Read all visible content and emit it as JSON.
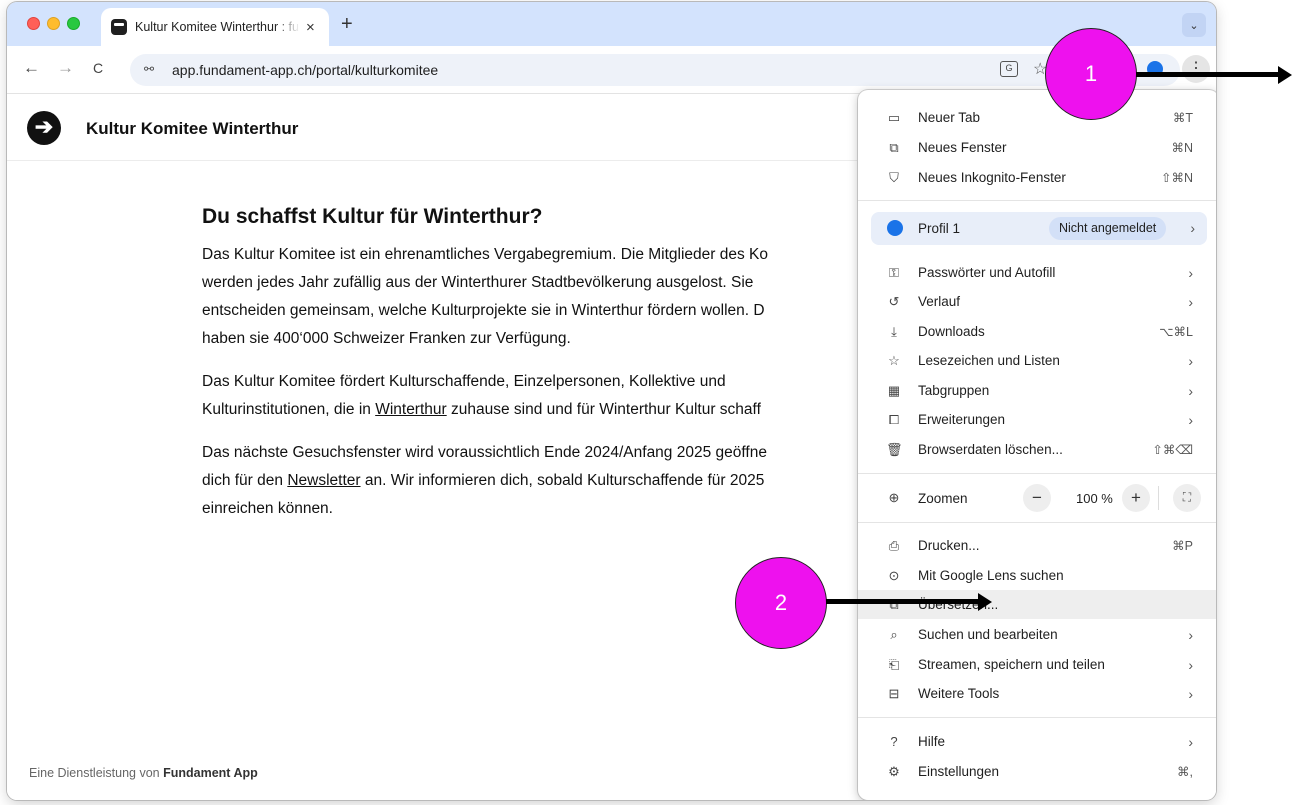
{
  "browser": {
    "tab_title": "Kultur Komitee Winterthur : fu",
    "tab_close": "×",
    "new_tab": "+",
    "tab_search": "⌄",
    "back": "←",
    "forward": "→",
    "reload": "C",
    "site_info": "⚯",
    "url": "app.fundament-app.ch/portal/kulturkomitee",
    "translate": "G",
    "bookmark": "☆",
    "menu": "⋮"
  },
  "site": {
    "logo_glyph": "➔",
    "name": "Kultur Komitee Winterthur",
    "headline": "Du schaffst Kultur für Winterthur?",
    "p1": [
      "Das Kultur Komitee ist ein ehrenamtliches Vergabegremium. Die Mitglieder des Ko",
      "werden jedes Jahr zufällig aus der Winterthurer Stadtbevölkerung ausgelost. Sie",
      "entscheiden gemeinsam, welche Kulturprojekte sie in Winterthur fördern wollen. D",
      "haben sie 400‘000 Schweizer Franken zur Verfügung."
    ],
    "p2_line1": "Das Kultur Komitee fördert Kulturschaffende, Einzelpersonen, Kollektive und",
    "p2_line2_before": "Kulturinstitutionen, die in ",
    "p2_link": "Winterthur",
    "p2_line2_after": " zuhause sind und für Winterthur Kultur schaff",
    "p3_line1": "Das nächste Gesuchsfenster wird voraussichtlich Ende 2024/Anfang 2025 geöffne",
    "p3_line2_before": "dich für den ",
    "p3_link": "Newsletter",
    "p3_line2_after": " an. Wir informieren dich, sobald Kulturschaffende für 2025",
    "p3_line3": "einreichen können.",
    "footer_prefix": "Eine Dienstleistung von ",
    "footer_brand": "Fundament App"
  },
  "menu": {
    "new_tab": {
      "icon": "▭",
      "label": "Neuer Tab",
      "shortcut": "⌘T"
    },
    "new_window": {
      "icon": "⧉",
      "label": "Neues Fenster",
      "shortcut": "⌘N"
    },
    "incognito": {
      "icon": "⛉",
      "label": "Neues Inkognito-Fenster",
      "shortcut": "⇧⌘N"
    },
    "profile": {
      "label": "Profil 1",
      "badge": "Nicht angemeldet",
      "arrow": "›"
    },
    "passwords": {
      "icon": "⚿",
      "label": "Passwörter und Autofill",
      "arrow": "›"
    },
    "history": {
      "icon": "↺",
      "label": "Verlauf",
      "arrow": "›"
    },
    "downloads": {
      "icon": "⤓",
      "label": "Downloads",
      "shortcut": "⌥⌘L"
    },
    "bookmarks": {
      "icon": "☆",
      "label": "Lesezeichen und Listen",
      "arrow": "›"
    },
    "tabgroups": {
      "icon": "▦",
      "label": "Tabgruppen",
      "arrow": "›"
    },
    "extensions": {
      "icon": "⧠",
      "label": "Erweiterungen",
      "arrow": "›"
    },
    "clear_data": {
      "icon": "🗑",
      "label": "Browserdaten löschen...",
      "shortcut": "⇧⌘⌫"
    },
    "zoom": {
      "icon": "⊕",
      "label": "Zoomen",
      "minus": "−",
      "value": "100 %",
      "plus": "+",
      "fullscreen": "⛶"
    },
    "print": {
      "icon": "⎙",
      "label": "Drucken...",
      "shortcut": "⌘P"
    },
    "lens": {
      "icon": "⊙",
      "label": "Mit Google Lens suchen"
    },
    "translate": {
      "icon": "⧉",
      "label": "Übersetzen..."
    },
    "find_edit": {
      "icon": "⌕",
      "label": "Suchen und bearbeiten",
      "arrow": "›"
    },
    "cast_save": {
      "icon": "⎗",
      "label": "Streamen, speichern und teilen",
      "arrow": "›"
    },
    "more_tools": {
      "icon": "⊟",
      "label": "Weitere Tools",
      "arrow": "›"
    },
    "help": {
      "icon": "?",
      "label": "Hilfe",
      "arrow": "›"
    },
    "settings": {
      "icon": "⚙",
      "label": "Einstellungen",
      "shortcut": "⌘,"
    }
  },
  "annotations": {
    "callout1": "1",
    "callout2": "2"
  },
  "colors": {
    "tabstrip": "#d3e3fd",
    "callout": "#ee11ee",
    "accent": "#1a73e8"
  }
}
